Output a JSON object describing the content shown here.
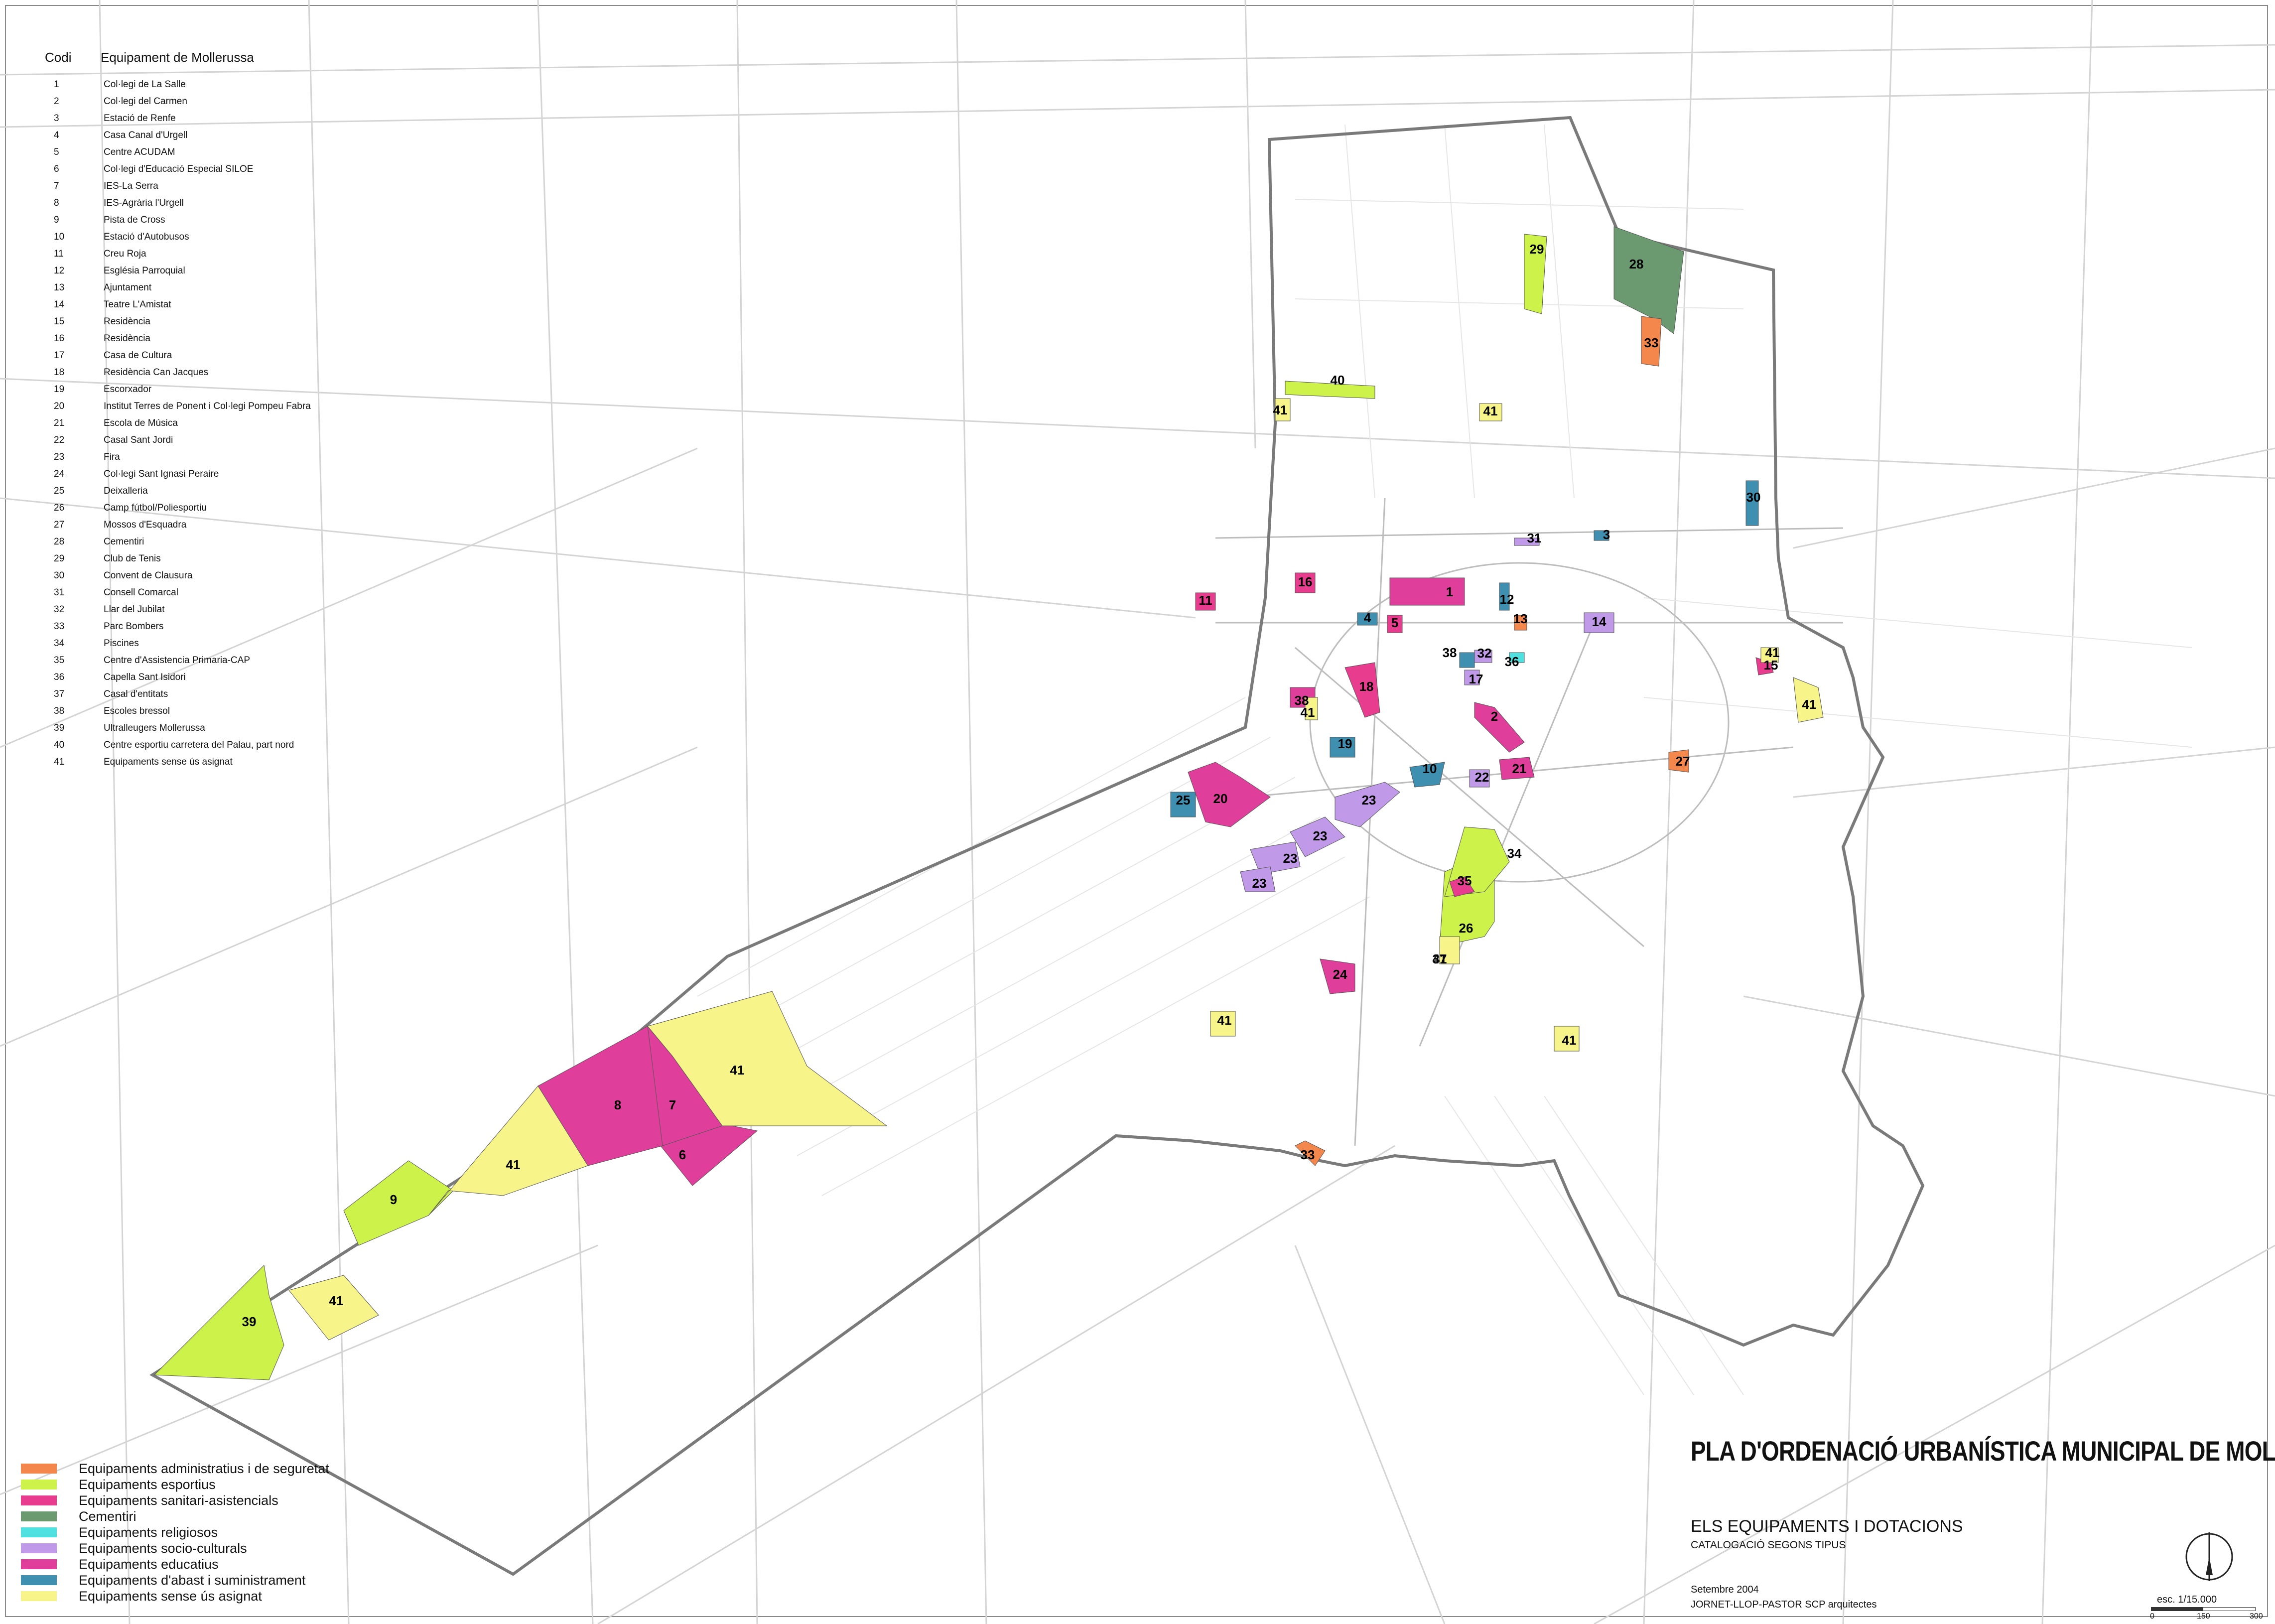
{
  "codes_header": {
    "code": "Codi",
    "name": "Equipament de Mollerussa"
  },
  "codes": [
    {
      "code": "1",
      "name": "Col·legi de La Salle"
    },
    {
      "code": "2",
      "name": "Col·legi del Carmen"
    },
    {
      "code": "3",
      "name": "Estació de Renfe"
    },
    {
      "code": "4",
      "name": "Casa Canal d'Urgell"
    },
    {
      "code": "5",
      "name": "Centre ACUDAM"
    },
    {
      "code": "6",
      "name": "Col·legi d'Educació Especial SILOE"
    },
    {
      "code": "7",
      "name": "IES-La Serra"
    },
    {
      "code": "8",
      "name": "IES-Agrària l'Urgell"
    },
    {
      "code": "9",
      "name": "Pista de Cross"
    },
    {
      "code": "10",
      "name": "Estació d'Autobusos"
    },
    {
      "code": "11",
      "name": "Creu Roja"
    },
    {
      "code": "12",
      "name": "Església Parroquial"
    },
    {
      "code": "13",
      "name": "Ajuntament"
    },
    {
      "code": "14",
      "name": "Teatre L'Amistat"
    },
    {
      "code": "15",
      "name": "Residència"
    },
    {
      "code": "16",
      "name": "Residència"
    },
    {
      "code": "17",
      "name": "Casa de Cultura"
    },
    {
      "code": "18",
      "name": "Residència Can Jacques"
    },
    {
      "code": "19",
      "name": "Escorxador"
    },
    {
      "code": "20",
      "name": "Institut Terres de Ponent i Col·legi Pompeu Fabra"
    },
    {
      "code": "21",
      "name": "Escola de Música"
    },
    {
      "code": "22",
      "name": "Casal Sant Jordi"
    },
    {
      "code": "23",
      "name": "Fira"
    },
    {
      "code": "24",
      "name": "Col·legi Sant Ignasi Peraire"
    },
    {
      "code": "25",
      "name": "Deixalleria"
    },
    {
      "code": "26",
      "name": "Camp fútbol/Poliesportiu"
    },
    {
      "code": "27",
      "name": "Mossos d'Esquadra"
    },
    {
      "code": "28",
      "name": "Cementiri"
    },
    {
      "code": "29",
      "name": "Club de Tenis"
    },
    {
      "code": "30",
      "name": "Convent de Clausura"
    },
    {
      "code": "31",
      "name": "Consell Comarcal"
    },
    {
      "code": "32",
      "name": "Llar del Jubilat"
    },
    {
      "code": "33",
      "name": "Parc Bombers"
    },
    {
      "code": "34",
      "name": "Piscines"
    },
    {
      "code": "35",
      "name": "Centre d'Assistencia Primaria-CAP"
    },
    {
      "code": "36",
      "name": "Capella Sant Isidori"
    },
    {
      "code": "37",
      "name": "Casal d'entitats"
    },
    {
      "code": "38",
      "name": "Escoles bressol"
    },
    {
      "code": "39",
      "name": "Ultralleugers Mollerussa"
    },
    {
      "code": "40",
      "name": "Centre esportiu carretera del Palau, part nord"
    },
    {
      "code": "41",
      "name": "Equipaments sense ús asignat"
    }
  ],
  "legend": [
    {
      "label": "Equipaments administratius i de seguretat",
      "color": "#f4874b"
    },
    {
      "label": "Equipaments esportius",
      "color": "#cdf24a"
    },
    {
      "label": "Equipaments sanitari-asistencials",
      "color": "#e83d8f"
    },
    {
      "label": "Cementiri",
      "color": "#6b9a71"
    },
    {
      "label": "Equipaments religiosos",
      "color": "#4fe0e0"
    },
    {
      "label": "Equipaments socio-culturals",
      "color": "#c09ae8"
    },
    {
      "label": "Equipaments educatius",
      "color": "#df3f9a"
    },
    {
      "label": "Equipaments d'abast i suministrament",
      "color": "#3f8fb0"
    },
    {
      "label": "Equipaments sense ús asignat",
      "color": "#f7f58a"
    }
  ],
  "title": {
    "main": "PLA D'ORDENACIÓ URBANÍSTICA MUNICIPAL DE MOLLERUSSA",
    "subtitle": "ELS EQUIPAMENTS I DOTACIONS",
    "subsubtitle": "CATALOGACIÓ SEGONS TIPUS",
    "date": "Setembre 2004",
    "authors": "JORNET-LLOP-PASTOR SCP   arquitectes"
  },
  "scale": {
    "label": "esc. 1/15.000",
    "ticks": [
      "0",
      "150",
      "300"
    ]
  },
  "zones": [
    {
      "label": "1",
      "type": "educatius"
    },
    {
      "label": "2",
      "type": "educatius"
    },
    {
      "label": "3",
      "type": "abast"
    },
    {
      "label": "4",
      "type": "abast"
    },
    {
      "label": "5",
      "type": "sanitari"
    },
    {
      "label": "6",
      "type": "educatius"
    },
    {
      "label": "7",
      "type": "educatius"
    },
    {
      "label": "8",
      "type": "educatius"
    },
    {
      "label": "9",
      "type": "esportius"
    },
    {
      "label": "10",
      "type": "abast"
    },
    {
      "label": "11",
      "type": "sanitari"
    },
    {
      "label": "12",
      "type": "abast"
    },
    {
      "label": "13",
      "type": "administratius"
    },
    {
      "label": "14",
      "type": "socio"
    },
    {
      "label": "15",
      "type": "sanitari"
    },
    {
      "label": "16",
      "type": "sanitari"
    },
    {
      "label": "17",
      "type": "socio"
    },
    {
      "label": "18",
      "type": "sanitari"
    },
    {
      "label": "19",
      "type": "abast"
    },
    {
      "label": "20",
      "type": "educatius"
    },
    {
      "label": "21",
      "type": "educatius"
    },
    {
      "label": "22",
      "type": "socio"
    },
    {
      "label": "23",
      "type": "socio"
    },
    {
      "label": "23",
      "type": "socio"
    },
    {
      "label": "23",
      "type": "socio"
    },
    {
      "label": "23",
      "type": "socio"
    },
    {
      "label": "24",
      "type": "educatius"
    },
    {
      "label": "25",
      "type": "abast"
    },
    {
      "label": "26",
      "type": "esportius"
    },
    {
      "label": "27",
      "type": "administratius"
    },
    {
      "label": "28",
      "type": "cementiri"
    },
    {
      "label": "29",
      "type": "esportius"
    },
    {
      "label": "30",
      "type": "abast"
    },
    {
      "label": "31",
      "type": "socio"
    },
    {
      "label": "32",
      "type": "socio"
    },
    {
      "label": "33",
      "type": "administratius"
    },
    {
      "label": "33",
      "type": "administratius"
    },
    {
      "label": "34",
      "type": "esportius"
    },
    {
      "label": "35",
      "type": "sanitari"
    },
    {
      "label": "36",
      "type": "religiosos"
    },
    {
      "label": "37",
      "type": "administratius"
    },
    {
      "label": "38",
      "type": "educatius"
    },
    {
      "label": "38",
      "type": "abast"
    },
    {
      "label": "39",
      "type": "esportius"
    },
    {
      "label": "40",
      "type": "esportius"
    },
    {
      "label": "41",
      "type": "sense"
    },
    {
      "label": "41",
      "type": "sense"
    },
    {
      "label": "41",
      "type": "sense"
    },
    {
      "label": "41",
      "type": "sense"
    },
    {
      "label": "41",
      "type": "sense"
    },
    {
      "label": "41",
      "type": "sense"
    },
    {
      "label": "41",
      "type": "sense"
    },
    {
      "label": "41",
      "type": "sense"
    },
    {
      "label": "41",
      "type": "sense"
    },
    {
      "label": "41",
      "type": "sense"
    },
    {
      "label": "41",
      "type": "sense"
    }
  ],
  "type_colors": {
    "administratius": "#f4874b",
    "esportius": "#cdf24a",
    "sanitari": "#e83d8f",
    "cementiri": "#6b9a71",
    "religiosos": "#4fe0e0",
    "socio": "#c09ae8",
    "educatius": "#df3f9a",
    "abast": "#3f8fb0",
    "sense": "#f7f58a"
  }
}
